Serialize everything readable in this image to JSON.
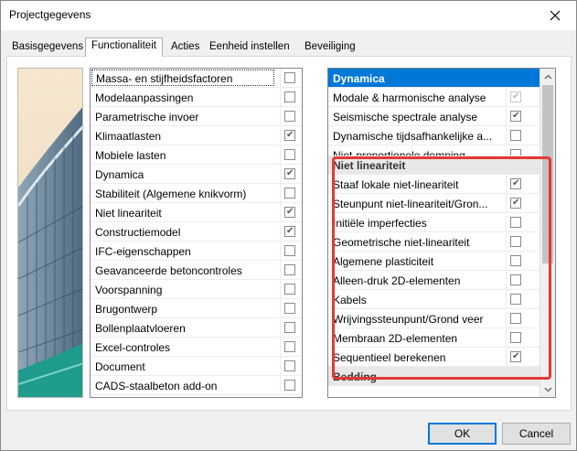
{
  "window": {
    "title": "Projectgegevens"
  },
  "tabs": [
    {
      "label": "Basisgegevens",
      "active": false
    },
    {
      "label": "Functionaliteit",
      "active": true
    },
    {
      "label": "Acties",
      "active": false
    },
    {
      "label": "Eenheid instellen",
      "active": false
    },
    {
      "label": "Beveiliging",
      "active": false
    }
  ],
  "left_list": [
    {
      "label": "Massa- en stijfheidsfactoren",
      "checked": false,
      "selected": true
    },
    {
      "label": "Modelaanpassingen",
      "checked": false
    },
    {
      "label": "Parametrische invoer",
      "checked": false
    },
    {
      "label": "Klimaatlasten",
      "checked": true
    },
    {
      "label": "Mobiele lasten",
      "checked": false
    },
    {
      "label": "Dynamica",
      "checked": true
    },
    {
      "label": "Stabiliteit (Algemene knikvorm)",
      "checked": false
    },
    {
      "label": "Niet lineariteit",
      "checked": true
    },
    {
      "label": "Constructiemodel",
      "checked": true
    },
    {
      "label": "IFC-eigenschappen",
      "checked": false
    },
    {
      "label": "Geavanceerde betoncontroles",
      "checked": false
    },
    {
      "label": "Voorspanning",
      "checked": false
    },
    {
      "label": "Brugontwerp",
      "checked": false
    },
    {
      "label": "Bollenplaatvloeren",
      "checked": false
    },
    {
      "label": "Excel-controles",
      "checked": false
    },
    {
      "label": "Document",
      "checked": false
    },
    {
      "label": "CADS-staalbeton add-on",
      "checked": false
    }
  ],
  "right_list": {
    "dynamica_heading": "Dynamica",
    "dynamica_items": [
      {
        "label": "Modale & harmonische analyse",
        "checked": true,
        "disabled": true
      },
      {
        "label": "Seismische spectrale analyse",
        "checked": true
      },
      {
        "label": "Dynamische tijdsafhankelijke a...",
        "checked": false
      },
      {
        "label": "Niet-proportionele demping",
        "checked": false
      }
    ],
    "niet_lin_heading": "Niet lineariteit",
    "niet_lin_items": [
      {
        "label": "Staaf lokale niet-lineariteit",
        "checked": true
      },
      {
        "label": "Steunpunt niet-lineariteit/Gron...",
        "checked": true
      },
      {
        "label": "Initiële imperfecties",
        "checked": false
      },
      {
        "label": "Geometrische niet-lineariteit",
        "checked": false
      },
      {
        "label": "Algemene plasticiteit",
        "checked": false
      },
      {
        "label": "Alleen-druk 2D-elementen",
        "checked": false
      },
      {
        "label": "Kabels",
        "checked": false
      },
      {
        "label": "Wrijvingssteunpunt/Grond veer",
        "checked": false
      },
      {
        "label": "Membraan 2D-elementen",
        "checked": false
      },
      {
        "label": "Sequentieel berekenen",
        "checked": true
      }
    ],
    "bedding_heading": "Bedding"
  },
  "buttons": {
    "ok": "OK",
    "cancel": "Cancel"
  },
  "colors": {
    "selection": "#0078d7",
    "highlight_box": "#e53935"
  }
}
